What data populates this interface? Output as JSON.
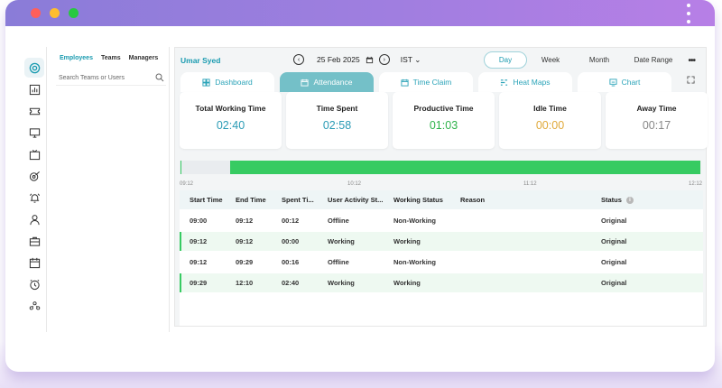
{
  "window": {
    "colors": {
      "close": "#ff5f5a",
      "minimize": "#ffbd2e",
      "maximize": "#28c840"
    }
  },
  "rail_icons": [
    "target-icon",
    "chart-icon",
    "ticket-icon",
    "monitor-icon",
    "calendar-tv-icon",
    "bulb-target-icon",
    "alarm-icon",
    "user-icon",
    "briefcase-icon",
    "calendar-icon",
    "clock-icon",
    "team-icon"
  ],
  "employees_panel": {
    "tabs": [
      "Employees",
      "Teams",
      "Managers"
    ],
    "search_placeholder": "Search Teams or Users"
  },
  "header": {
    "user_name": "Umar Syed",
    "date": "25 Feb 2025",
    "timezone": "IST",
    "range_tabs": [
      "Day",
      "Week",
      "Month",
      "Date Range"
    ],
    "active_range": "Day"
  },
  "tabs": [
    {
      "label": "Dashboard",
      "icon": "dashboard-icon"
    },
    {
      "label": "Attendance",
      "icon": "calendar-icon"
    },
    {
      "label": "Time Claim",
      "icon": "calendar-icon"
    },
    {
      "label": "Heat Maps",
      "icon": "heatmap-icon"
    },
    {
      "label": "Chart",
      "icon": "chart-icon"
    }
  ],
  "active_tab": "Attendance",
  "cards": [
    {
      "label": "Total Working Time",
      "value": "02:40",
      "color": "#2a9bb5"
    },
    {
      "label": "Time Spent",
      "value": "02:58",
      "color": "#2a9bb5"
    },
    {
      "label": "Productive Time",
      "value": "01:03",
      "color": "#2eb24a"
    },
    {
      "label": "Idle Time",
      "value": "00:00",
      "color": "#e0a93a"
    },
    {
      "label": "Away Time",
      "value": "00:17",
      "color": "#888888"
    }
  ],
  "timeline": {
    "axis_labels": [
      "09:12",
      "10:12",
      "11:12",
      "12:12"
    ],
    "bar_color": "#37cb62"
  },
  "table": {
    "headers": [
      "Start Time",
      "End Time",
      "Spent Ti...",
      "User Activity St...",
      "Working Status",
      "Reason",
      "Status"
    ],
    "rows": [
      {
        "start": "09:00",
        "end": "09:12",
        "spent": "00:12",
        "activity": "Offline",
        "working": "Non-Working",
        "reason": "",
        "status": "Original"
      },
      {
        "start": "09:12",
        "end": "09:12",
        "spent": "00:00",
        "activity": "Working",
        "working": "Working",
        "reason": "",
        "status": "Original"
      },
      {
        "start": "09:12",
        "end": "09:29",
        "spent": "00:16",
        "activity": "Offline",
        "working": "Non-Working",
        "reason": "",
        "status": "Original"
      },
      {
        "start": "09:29",
        "end": "12:10",
        "spent": "02:40",
        "activity": "Working",
        "working": "Working",
        "reason": "",
        "status": "Original"
      }
    ]
  }
}
